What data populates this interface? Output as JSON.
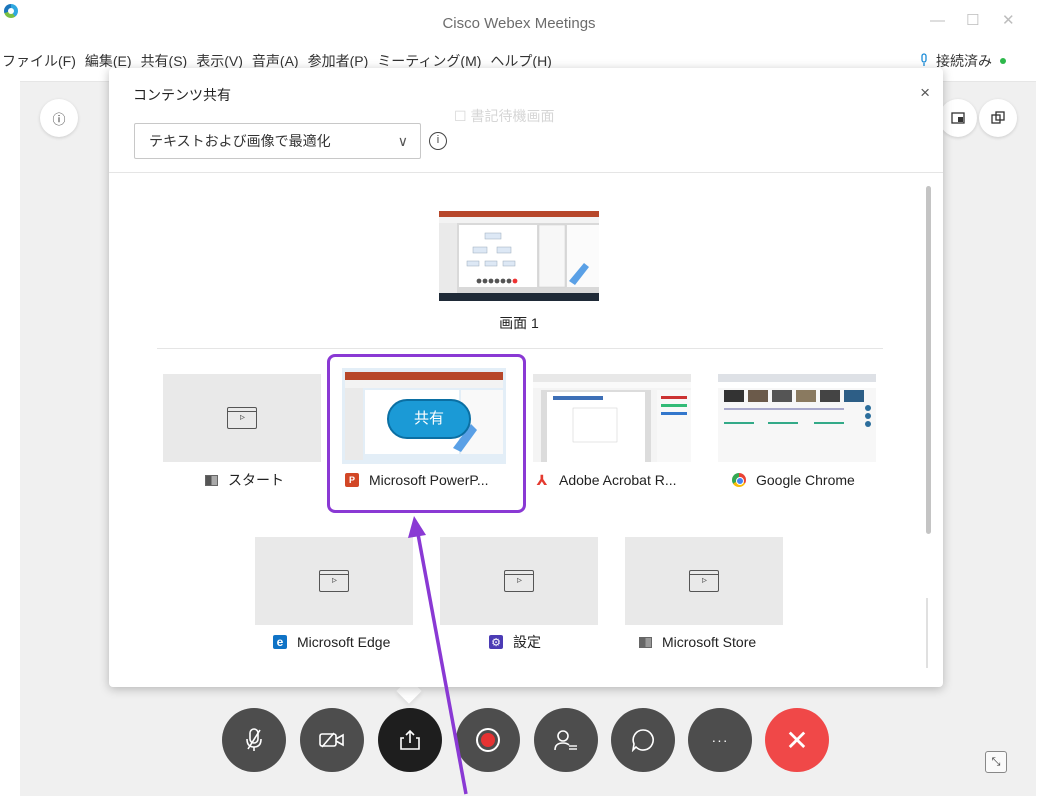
{
  "window": {
    "title": "Cisco Webex Meetings",
    "minimize": "—",
    "maximize": "☐",
    "close": "✕"
  },
  "menu": [
    "ファイル(F)",
    "編集(E)",
    "共有(S)",
    "表示(V)",
    "音声(A)",
    "参加者(P)",
    "ミーティング(M)",
    "ヘルプ(H)"
  ],
  "status": {
    "label": "接続済み",
    "color": "#2db84b"
  },
  "stage_buttons": {
    "info": "ⓘ"
  },
  "dialog": {
    "title": "コンテンツ共有",
    "close": "×",
    "background_text": "☐ 書記待機画面",
    "optimize_select": {
      "value": "テキストおよび画像で最適化",
      "chevron": "∨"
    },
    "info_icon": "i",
    "screen": {
      "label": "画面 1"
    },
    "apps": [
      {
        "label": "スタート",
        "icon": "start-icon"
      },
      {
        "label": "Microsoft PowerP...",
        "icon": "powerpoint-icon",
        "badge": "P"
      },
      {
        "label": "Adobe Acrobat R...",
        "icon": "acrobat-icon",
        "badge": "⅄"
      },
      {
        "label": "Google Chrome",
        "icon": "chrome-icon"
      },
      {
        "label": "Microsoft Edge",
        "icon": "edge-icon",
        "badge": "e"
      },
      {
        "label": "設定",
        "icon": "settings-icon",
        "badge": "⚙"
      },
      {
        "label": "Microsoft Store",
        "icon": "store-icon"
      }
    ],
    "share_overlay": "共有"
  },
  "controls": {
    "mute": "mute-icon",
    "video": "video-off-icon",
    "share": "share-icon",
    "record": "record-icon",
    "participants": "participants-icon",
    "chat": "chat-icon",
    "more": "···",
    "end": "✕",
    "corner": "⤡"
  },
  "colors": {
    "accent": "#8a39d4",
    "share_blue": "#1b9ad6",
    "end_red": "#f04848"
  }
}
